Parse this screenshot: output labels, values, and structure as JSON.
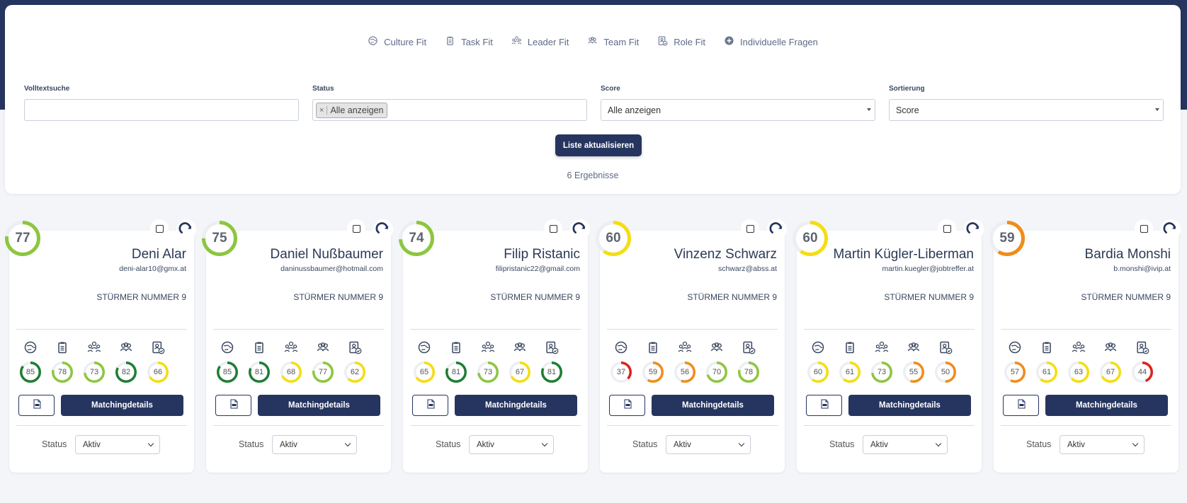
{
  "fit_tabs": [
    {
      "label": "Culture Fit",
      "icon": "culture-fit-icon"
    },
    {
      "label": "Task Fit",
      "icon": "task-fit-icon"
    },
    {
      "label": "Leader Fit",
      "icon": "leader-fit-icon"
    },
    {
      "label": "Team Fit",
      "icon": "team-fit-icon"
    },
    {
      "label": "Role Fit",
      "icon": "role-fit-icon"
    },
    {
      "label": "Individuelle Fragen",
      "icon": "plus-circle-icon"
    }
  ],
  "filters": {
    "fulltext": {
      "label": "Volltextsuche",
      "value": ""
    },
    "status": {
      "label": "Status",
      "tag": "Alle anzeigen",
      "remove": "×"
    },
    "score": {
      "label": "Score",
      "value": "Alle anzeigen"
    },
    "sort": {
      "label": "Sortierung",
      "value": "Score"
    }
  },
  "refresh_button": "Liste aktualisieren",
  "results_count": "6 Ergebnisse",
  "colors": {
    "navy": "#26355f",
    "dark_green": "#1e7e34",
    "light_green": "#8cc63f",
    "yellow": "#f5dd12",
    "orange": "#f08c1a",
    "red": "#d9231d"
  },
  "card_labels": {
    "details_button": "Matchingdetails",
    "status_label": "Status",
    "status_value": "Aktiv",
    "pdf_icon": "pdf-file-icon"
  },
  "candidates": [
    {
      "score": 77,
      "name": "Deni Alar",
      "email": "deni-alar10@gmx.at",
      "position": "STÜRMER NUMMER 9",
      "sub_scores": [
        85,
        78,
        73,
        82,
        66
      ]
    },
    {
      "score": 75,
      "name": "Daniel Nußbaumer",
      "email": "daninussbaumer@hotmail.com",
      "position": "STÜRMER NUMMER 9",
      "sub_scores": [
        85,
        81,
        68,
        77,
        62
      ]
    },
    {
      "score": 74,
      "name": "Filip Ristanic",
      "email": "filipristanic22@gmail.com",
      "position": "STÜRMER NUMMER 9",
      "sub_scores": [
        65,
        81,
        73,
        67,
        81
      ]
    },
    {
      "score": 60,
      "name": "Vinzenz Schwarz",
      "email": "schwarz@abss.at",
      "position": "STÜRMER NUMMER 9",
      "sub_scores": [
        37,
        59,
        56,
        70,
        78
      ]
    },
    {
      "score": 60,
      "name": "Martin Kügler-Liberman",
      "email": "martin.kuegler@jobtreffer.at",
      "position": "STÜRMER NUMMER 9",
      "sub_scores": [
        60,
        61,
        73,
        55,
        50
      ]
    },
    {
      "score": 59,
      "name": "Bardia Monshi",
      "email": "b.monshi@ivip.at",
      "position": "STÜRMER NUMMER 9",
      "sub_scores": [
        57,
        61,
        63,
        67,
        44
      ]
    }
  ]
}
